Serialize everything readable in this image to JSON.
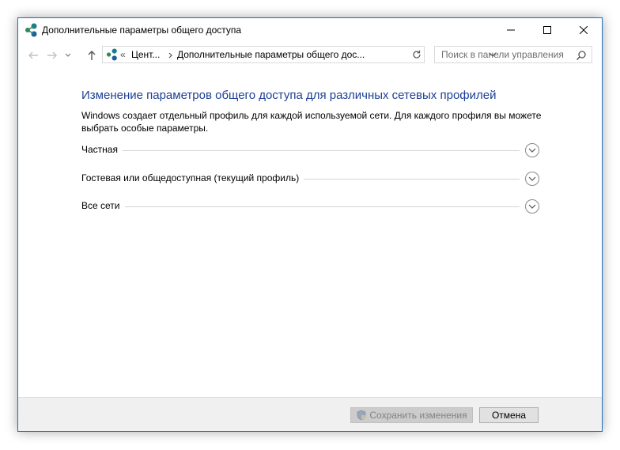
{
  "window": {
    "title": "Дополнительные параметры общего доступа",
    "icon": "network-sharing-icon",
    "controls": [
      "minimize-icon",
      "maximize-icon",
      "close-icon"
    ]
  },
  "address_bar": {
    "prefix": "«",
    "crumbs": [
      "Цент...",
      "Дополнительные параметры общего дос..."
    ]
  },
  "search": {
    "placeholder": "Поиск в панели управления"
  },
  "main": {
    "heading": "Изменение параметров общего доступа для различных сетевых профилей",
    "description": "Windows создает отдельный профиль для каждой используемой сети. Для каждого профиля вы можете выбрать особые параметры.",
    "sections": [
      {
        "label": "Частная"
      },
      {
        "label": "Гостевая или общедоступная (текущий профиль)"
      },
      {
        "label": "Все сети"
      }
    ]
  },
  "footer": {
    "save_label": "Сохранить изменения",
    "cancel_label": "Отмена"
  },
  "colors": {
    "heading": "#1c3f95",
    "border": "#1e6fc0",
    "footer_bg": "#f0f0f0"
  }
}
